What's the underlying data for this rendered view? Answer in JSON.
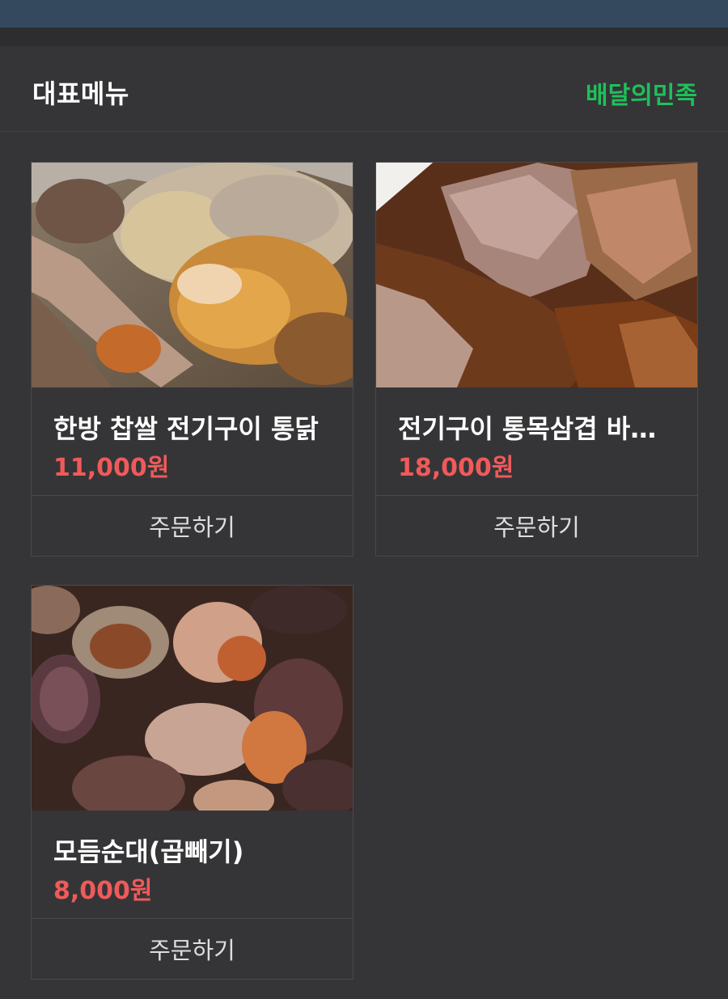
{
  "header": {
    "title": "대표메뉴",
    "brand_link": "배달의민족"
  },
  "menu_items": [
    {
      "name": "한방 찹쌀 전기구이 통닭",
      "price": "11,000원",
      "order_label": "주문하기",
      "image": "roast-chicken-photo"
    },
    {
      "name": "전기구이 통목삼겹 바베큐",
      "price": "18,000원",
      "order_label": "주문하기",
      "image": "roast-pork-belly-photo"
    },
    {
      "name": "모듬순대(곱빼기)",
      "price": "8,000원",
      "order_label": "주문하기",
      "image": "assorted-sundae-photo"
    }
  ],
  "colors": {
    "background": "#353537",
    "top_bar": "#34495e",
    "brand_green": "#1ec05a",
    "price_red": "#f05a5a"
  }
}
